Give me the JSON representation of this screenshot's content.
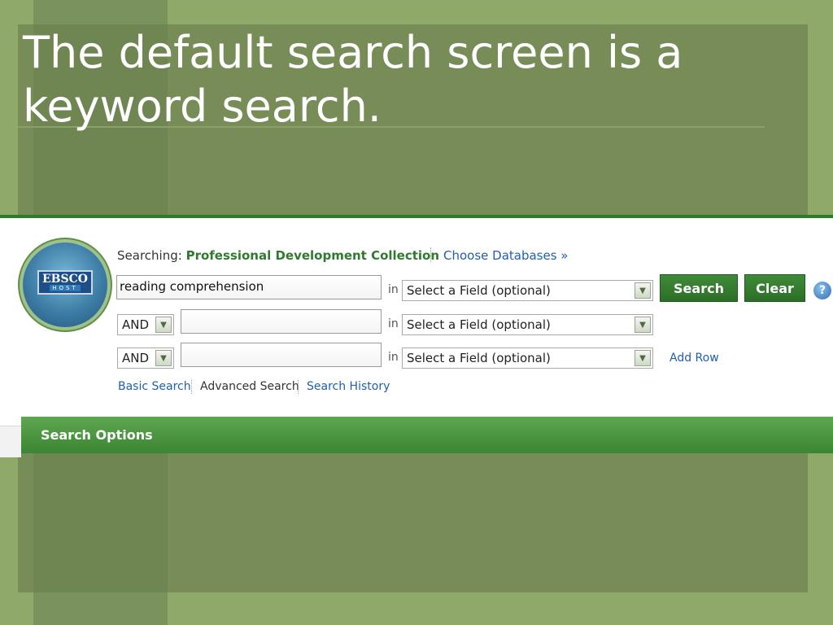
{
  "slide": {
    "title": "The default search screen is a keyword search."
  },
  "logo": {
    "top": "EBSCO",
    "bottom": "HOST"
  },
  "header": {
    "searching_label": "Searching:",
    "collection": "Professional Development Collection",
    "choose_databases": "Choose Databases »"
  },
  "rows": [
    {
      "value": "reading comprehension",
      "in": "in",
      "field": "Select a Field (optional)"
    },
    {
      "operator": "AND",
      "value": "",
      "in": "in",
      "field": "Select a Field (optional)"
    },
    {
      "operator": "AND",
      "value": "",
      "in": "in",
      "field": "Select a Field (optional)"
    }
  ],
  "buttons": {
    "search": "Search",
    "clear": "Clear",
    "add_row": "Add Row",
    "help": "?"
  },
  "tabs": {
    "basic": "Basic Search",
    "advanced": "Advanced Search",
    "history": "Search History"
  },
  "options_bar": {
    "label": "Search Options"
  },
  "colors": {
    "slide_bg": "#8fa96b",
    "accent_green": "#2f7a2f",
    "link_blue": "#1f5fae"
  }
}
